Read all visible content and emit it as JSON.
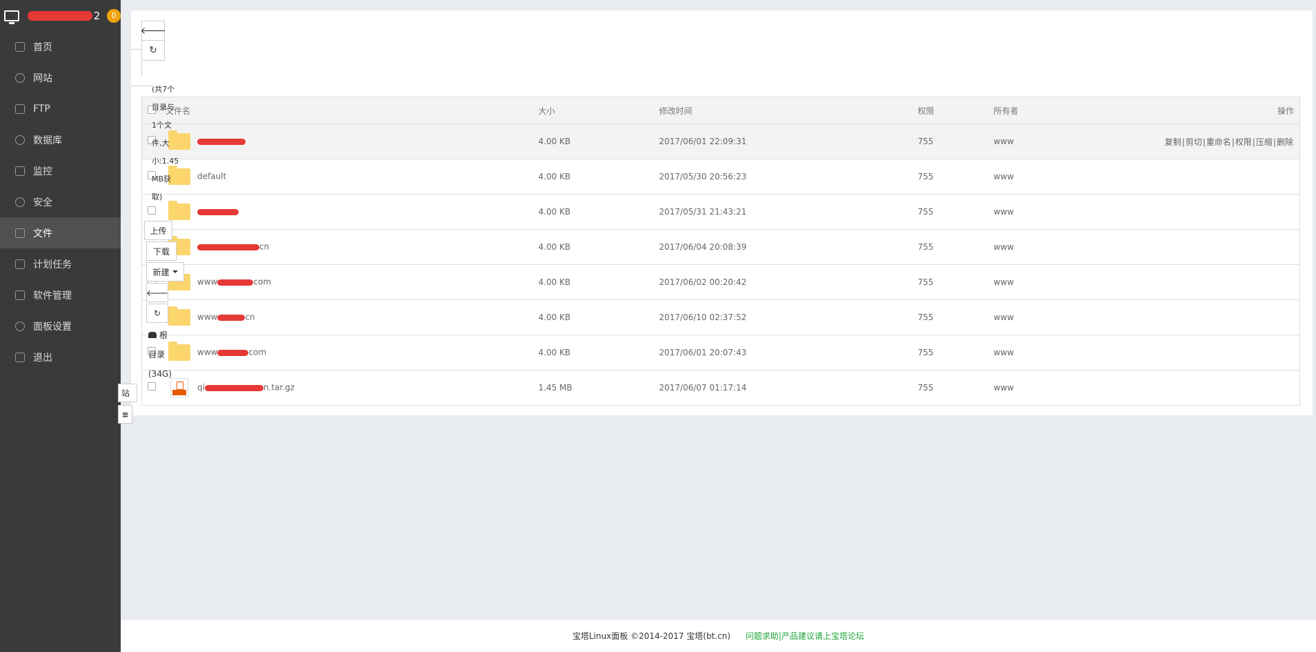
{
  "sidebar": {
    "host_suffix": "2",
    "badge": "0",
    "items": [
      {
        "label": "首页",
        "icon": "home-icon"
      },
      {
        "label": "网站",
        "icon": "globe-icon"
      },
      {
        "label": "FTP",
        "icon": "ftp-icon"
      },
      {
        "label": "数据库",
        "icon": "database-icon"
      },
      {
        "label": "监控",
        "icon": "monitor-chart-icon"
      },
      {
        "label": "安全",
        "icon": "shield-icon"
      },
      {
        "label": "文件",
        "icon": "folder-icon"
      },
      {
        "label": "计划任务",
        "icon": "calendar-icon"
      },
      {
        "label": "软件管理",
        "icon": "grid-icon"
      },
      {
        "label": "面板设置",
        "icon": "gear-icon"
      },
      {
        "label": "退出",
        "icon": "logout-icon"
      }
    ]
  },
  "toolbar": {
    "info_lines": [
      "(共7个",
      "目录与",
      "1个文",
      "件,大",
      "小:1.45",
      "MB获",
      "取)"
    ],
    "upload": "上传",
    "download": "下载",
    "new": "新建",
    "disk_line1": "根",
    "disk_line2": "目录",
    "disk_line3": "(34G)",
    "recycle_fragment": "站",
    "back_glyph": "🡐",
    "refresh_glyph": "↻"
  },
  "table": {
    "headers": {
      "name": "文件名",
      "size": "大小",
      "mtime": "修改时间",
      "perm": "权限",
      "owner": "所有者",
      "ops": "操作"
    },
    "rows": [
      {
        "name": "",
        "size": "4.00 KB",
        "mtime": "2017/06/01 22:09:31",
        "perm": "755",
        "owner": "www"
      },
      {
        "name": "default",
        "size": "4.00 KB",
        "mtime": "2017/05/30 20:56:23",
        "perm": "755",
        "owner": "www"
      },
      {
        "name": "",
        "size": "4.00 KB",
        "mtime": "2017/05/31 21:43:21",
        "perm": "755",
        "owner": "www"
      },
      {
        "name": "cn",
        "size": "4.00 KB",
        "mtime": "2017/06/04 20:08:39",
        "perm": "755",
        "owner": "www"
      },
      {
        "name": "www",
        "name_tail": "com",
        "size": "4.00 KB",
        "mtime": "2017/06/02 00:20:42",
        "perm": "755",
        "owner": "www"
      },
      {
        "name": "www",
        "name_tail": "cn",
        "size": "4.00 KB",
        "mtime": "2017/06/10 02:37:52",
        "perm": "755",
        "owner": "www"
      },
      {
        "name": "www",
        "name_tail": "com",
        "size": "4.00 KB",
        "mtime": "2017/06/01 20:07:43",
        "perm": "755",
        "owner": "www"
      },
      {
        "name": "qi",
        "name_tail": "n.tar.gz",
        "size": "1.45 MB",
        "mtime": "2017/06/07 01:17:14",
        "perm": "755",
        "owner": "www"
      }
    ],
    "row_ops": [
      "复制",
      "剪切",
      "重命名",
      "权限",
      "压缩",
      "删除"
    ]
  },
  "footer": {
    "copyright": "宝塔Linux面板 ©2014-2017 宝塔(bt.cn)",
    "link": "问题求助|产品建议请上宝塔论坛"
  }
}
